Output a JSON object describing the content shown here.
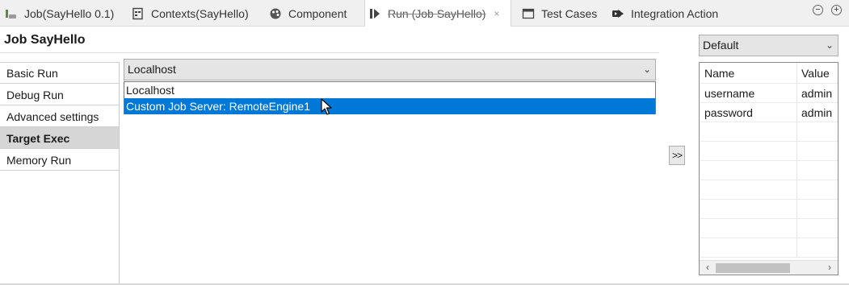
{
  "tabs": [
    {
      "label": "Job(SayHello 0.1)",
      "icon": "job-icon"
    },
    {
      "label": "Contexts(SayHello)",
      "icon": "contexts-icon"
    },
    {
      "label": "Component",
      "icon": "component-icon"
    },
    {
      "label": "Run (Job SayHello)",
      "icon": "run-icon",
      "active": true
    },
    {
      "label": "Test Cases",
      "icon": "test-cases-icon"
    },
    {
      "label": "Integration Action",
      "icon": "integration-action-icon"
    }
  ],
  "window_controls": {
    "minimize": "−",
    "maximize": "+"
  },
  "tab_close": "×",
  "title": "Job SayHello",
  "nav": {
    "items": [
      "Basic Run",
      "Debug Run",
      "Advanced settings",
      "Target Exec",
      "Memory Run"
    ],
    "selected_index": 3
  },
  "target": {
    "value": "Localhost",
    "options": [
      "Localhost",
      "Custom Job Server: RemoteEngine1"
    ],
    "highlighted_index": 1
  },
  "move_button": ">>",
  "context": {
    "selected": "Default",
    "headers": {
      "name": "Name",
      "value": "Value"
    },
    "rows": [
      {
        "name": "username",
        "value": "admin"
      },
      {
        "name": "password",
        "value": "admin"
      }
    ]
  },
  "colors": {
    "highlight": "#0078d7",
    "selected_nav": "#d6d6d6"
  }
}
